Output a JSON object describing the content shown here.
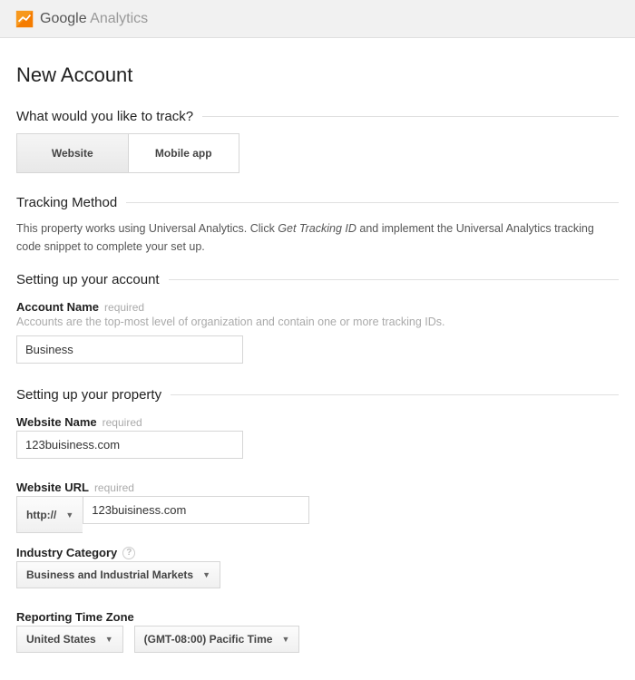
{
  "brand": {
    "bold": "Google",
    "light": " Analytics"
  },
  "page_title": "New Account",
  "sections": {
    "track_q": "What would you like to track?",
    "tracking_method": "Tracking Method",
    "setup_account": "Setting up your account",
    "setup_property": "Setting up your property"
  },
  "tabs": {
    "website": "Website",
    "mobile": "Mobile app"
  },
  "tracking_desc": {
    "pre": "This property works using Universal Analytics. Click ",
    "em": "Get Tracking ID",
    "post": " and implement the Universal Analytics tracking code snippet to complete your set up."
  },
  "account": {
    "name_label": "Account Name",
    "required": "required",
    "hint": "Accounts are the top-most level of organization and contain one or more tracking IDs.",
    "name_value": "Business"
  },
  "property": {
    "website_name_label": "Website Name",
    "website_name_value": "123buisiness.com",
    "website_url_label": "Website URL",
    "protocol": "http://",
    "website_url_value": "123buisiness.com",
    "industry_label": "Industry Category",
    "industry_value": "Business and Industrial Markets",
    "tz_label": "Reporting Time Zone",
    "tz_country": "United States",
    "tz_value": "(GMT-08:00) Pacific Time"
  }
}
